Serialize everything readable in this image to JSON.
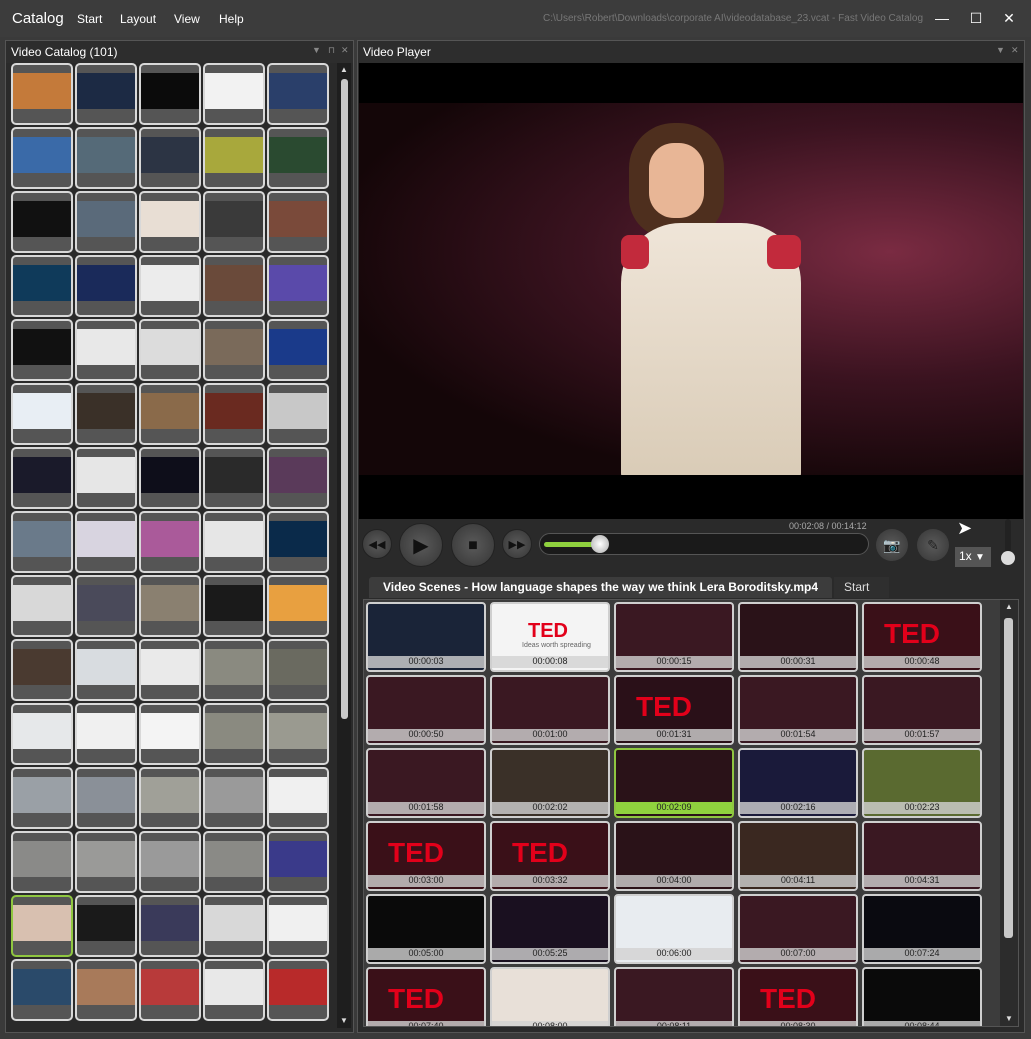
{
  "app": {
    "title": "Catalog",
    "menu": [
      "Start",
      "Layout",
      "View",
      "Help"
    ],
    "window_path": "C:\\Users\\Robert\\Downloads\\corporate AI\\videodatabase_23.vcat - Fast Video Catalog",
    "controls": {
      "minimize": "—",
      "maximize": "☐",
      "close": "✕"
    }
  },
  "catalog": {
    "title": "Video Catalog (101)",
    "thumb_colors": [
      "#c47a3a",
      "#1c2a44",
      "#0b0b0b",
      "#f2f2f2",
      "#2a3f6a",
      "#3a6aa8",
      "#556a78",
      "#2c3444",
      "#a8a83c",
      "#2a4a30",
      "#111111",
      "#5a6a7a",
      "#e8ded4",
      "#3a3a3a",
      "#7a4a3a",
      "#0f3a5a",
      "#1a2a5a",
      "#ececec",
      "#6a4a3a",
      "#5a4aaa",
      "#111111",
      "#e8e8e8",
      "#dcdcdc",
      "#7a6a5a",
      "#1a3a8a",
      "#e8eef4",
      "#3a3028",
      "#8a6a4a",
      "#6a2a20",
      "#c8c8c8",
      "#1a1a2a",
      "#e6e6e6",
      "#0e0e1a",
      "#2a2a2a",
      "#5a3a5a",
      "#6a7a8a",
      "#d8d4e0",
      "#aa5a9a",
      "#e6e6e6",
      "#0a2a4a",
      "#d8d8d8",
      "#4a4a5a",
      "#8a8070",
      "#1a1a1a",
      "#e8a040",
      "#4a3a30",
      "#d8dce0",
      "#eaeaea",
      "#8a8a80",
      "#6a6a60",
      "#e6e8ea",
      "#f0f0f0",
      "#f4f4f4",
      "#8a8a80",
      "#9a9a90",
      "#9aa0a6",
      "#8a9098",
      "#a0a098",
      "#9a9a9a",
      "#f0f0f0",
      "#8a8a88",
      "#9a9a98",
      "#9a9a9a",
      "#8a8a86",
      "#3a3a8a",
      "#d8c0b0",
      "#1a1a1a",
      "#3a3a5a",
      "#d8d8d8",
      "#f0f0f0",
      "#2a4a6a",
      "#a87a5a",
      "#b83a3a",
      "#e8e8e8",
      "#b82a2a"
    ],
    "selected_index": 65
  },
  "player": {
    "title": "Video Player",
    "time": "00:02:08 / 00:14:12",
    "progress": 0.17,
    "speed": "1x",
    "volume": 0.1
  },
  "scenes": {
    "tab_title": "Video Scenes - How language shapes the way we think Lera Boroditsky.mp4",
    "tab_start": "Start",
    "ted_brand": "TED",
    "ted_tagline": "Ideas worth spreading",
    "items": [
      {
        "time": "00:00:03",
        "bg": "#1a2438"
      },
      {
        "time": "00:00:08",
        "bg": "#f4f4f4",
        "ted_title": true
      },
      {
        "time": "00:00:15",
        "bg": "#3a1822"
      },
      {
        "time": "00:00:31",
        "bg": "#2a1218"
      },
      {
        "time": "00:00:48",
        "bg": "#3a1018",
        "ted": true
      },
      {
        "time": "00:00:50",
        "bg": "#3a1822"
      },
      {
        "time": "00:01:00",
        "bg": "#3a1822"
      },
      {
        "time": "00:01:31",
        "bg": "#2a1018",
        "ted": true
      },
      {
        "time": "00:01:54",
        "bg": "#3a1822"
      },
      {
        "time": "00:01:57",
        "bg": "#3a1822"
      },
      {
        "time": "00:01:58",
        "bg": "#3a1822"
      },
      {
        "time": "00:02:02",
        "bg": "#3a3028"
      },
      {
        "time": "00:02:09",
        "bg": "#2a1218",
        "selected": true
      },
      {
        "time": "00:02:16",
        "bg": "#1a1a3a"
      },
      {
        "time": "00:02:23",
        "bg": "#5a6a30"
      },
      {
        "time": "00:03:00",
        "bg": "#3a1018",
        "ted": true
      },
      {
        "time": "00:03:32",
        "bg": "#3a1018",
        "ted": true
      },
      {
        "time": "00:04:00",
        "bg": "#2a1218"
      },
      {
        "time": "00:04:11",
        "bg": "#3a2820"
      },
      {
        "time": "00:04:31",
        "bg": "#3a1822"
      },
      {
        "time": "00:05:00",
        "bg": "#0a0a0a"
      },
      {
        "time": "00:05:25",
        "bg": "#1a1020"
      },
      {
        "time": "00:06:00",
        "bg": "#e8ecf0"
      },
      {
        "time": "00:07:00",
        "bg": "#3a1822"
      },
      {
        "time": "00:07:24",
        "bg": "#0a0a10"
      },
      {
        "time": "00:07:40",
        "bg": "#3a1018",
        "ted": true
      },
      {
        "time": "00:08:00",
        "bg": "#e8e0d8"
      },
      {
        "time": "00:08:11",
        "bg": "#3a1822"
      },
      {
        "time": "00:08:30",
        "bg": "#3a1018",
        "ted": true
      },
      {
        "time": "00:08:44",
        "bg": "#0a0a0a"
      }
    ]
  }
}
